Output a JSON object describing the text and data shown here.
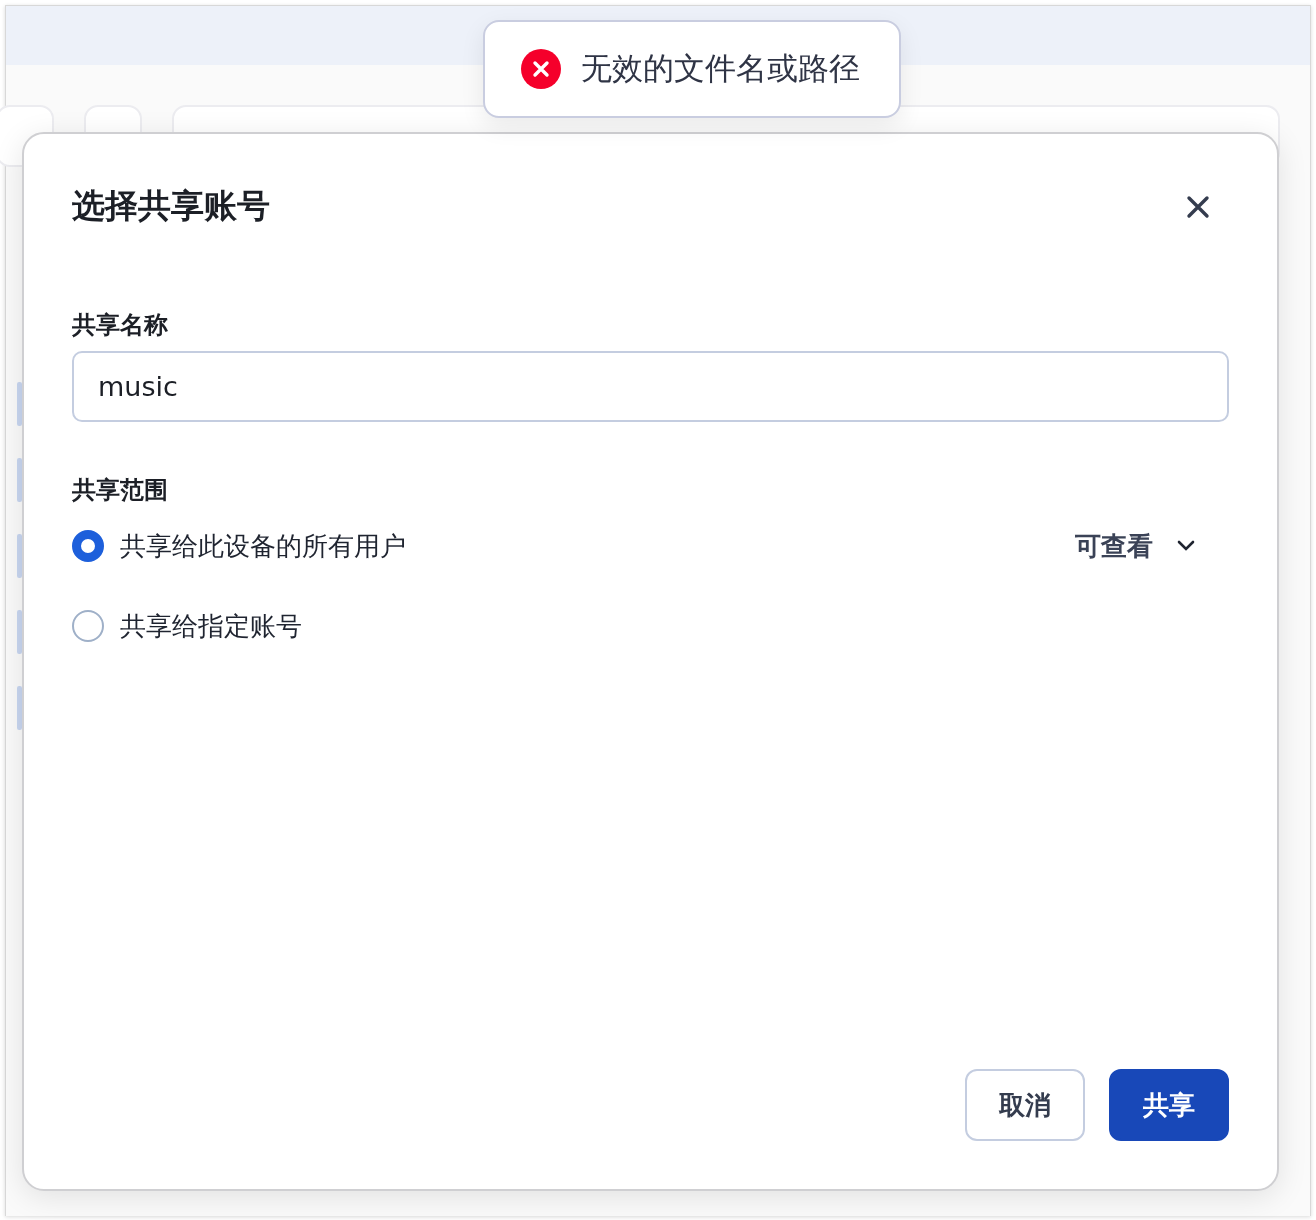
{
  "toast": {
    "kind": "error",
    "message": "无效的文件名或路径"
  },
  "dialog": {
    "title": "选择共享账号",
    "name_field": {
      "label": "共享名称",
      "value": "music"
    },
    "scope": {
      "label": "共享范围",
      "options": [
        {
          "label": "共享给此设备的所有用户",
          "selected": true,
          "permission": "可查看"
        },
        {
          "label": "共享给指定账号",
          "selected": false
        }
      ]
    },
    "buttons": [
      {
        "label": "取消",
        "kind": "secondary"
      },
      {
        "label": "共享",
        "kind": "primary"
      }
    ]
  }
}
